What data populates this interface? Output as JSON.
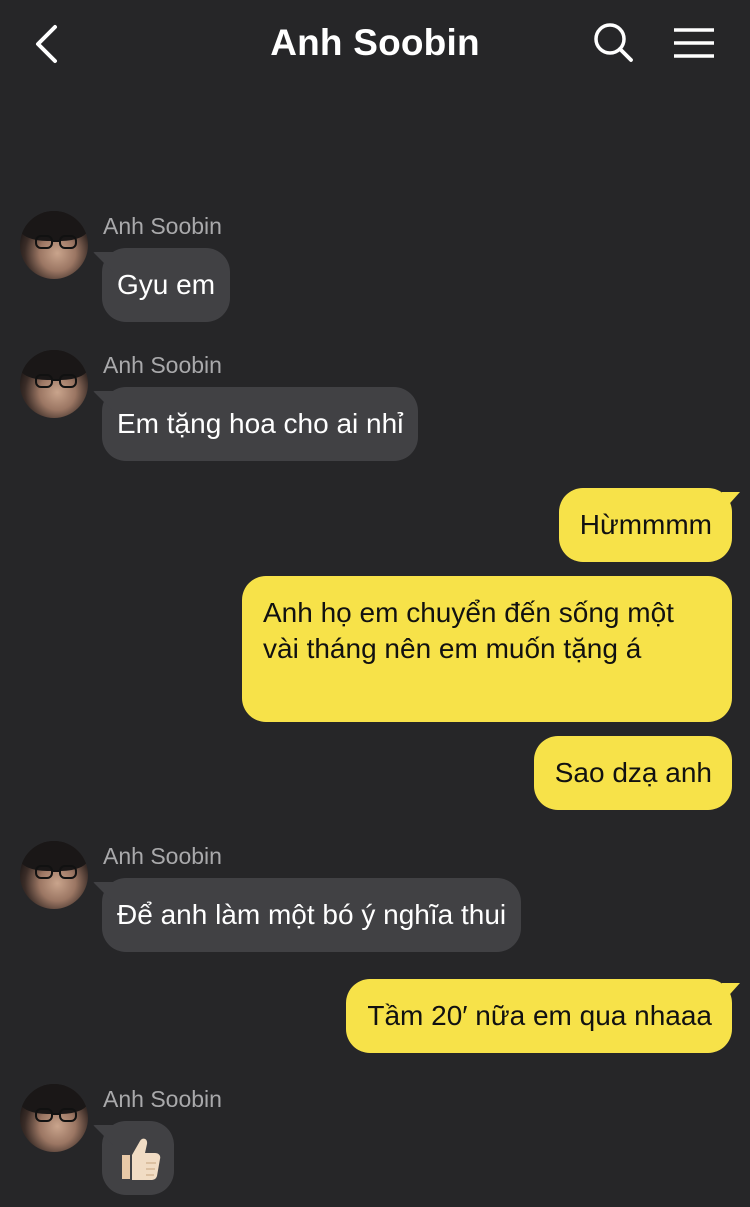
{
  "header": {
    "title": "Anh Soobin",
    "back_icon": "chevron-left-icon",
    "search_icon": "search-icon",
    "menu_icon": "hamburger-menu-icon"
  },
  "colors": {
    "background": "#262628",
    "incoming_bubble": "#414144",
    "outgoing_bubble": "#f7e249",
    "sender_name": "#a9a9ab"
  },
  "messages": [
    {
      "direction": "incoming",
      "sender": "Anh Soobin",
      "text": "Gyu em"
    },
    {
      "direction": "incoming",
      "sender": "Anh Soobin",
      "text": "Em tặng hoa cho ai nhỉ"
    },
    {
      "direction": "outgoing",
      "text": "Hừmmmm"
    },
    {
      "direction": "outgoing",
      "text": "Anh họ em chuyển đến sống một vài tháng nên em muốn tặng á"
    },
    {
      "direction": "outgoing",
      "text": "Sao dzạ anh"
    },
    {
      "direction": "incoming",
      "sender": "Anh Soobin",
      "text": "Để anh làm một bó ý nghĩa thui"
    },
    {
      "direction": "outgoing",
      "text": "Tầm 20′ nữa em qua nhaaa"
    },
    {
      "direction": "incoming",
      "sender": "Anh Soobin",
      "text": "👍🏻"
    }
  ]
}
